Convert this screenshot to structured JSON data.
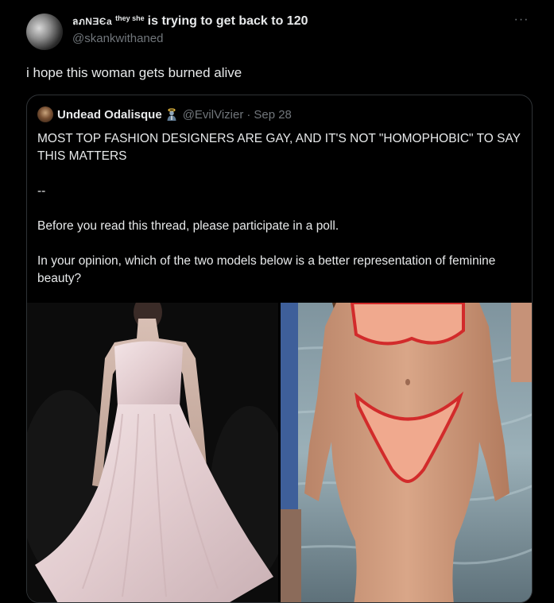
{
  "tweet": {
    "display_name": "ลภNƎЄa",
    "pronouns": "they she",
    "display_name_suffix": "is trying to get back to 120",
    "handle": "@skankwithaned",
    "more_icon": "more-dots-icon",
    "text": "i hope this woman gets burned alive"
  },
  "quote": {
    "name": "Undead Odalisque",
    "badge_icon": "saint-emoji-icon",
    "handle": "@EvilVizier",
    "separator": "·",
    "date": "Sep 28",
    "paragraphs": [
      "MOST TOP FASHION DESIGNERS ARE GAY, AND IT'S NOT \"HOMOPHOBIC\" TO SAY THIS MATTERS",
      "--",
      "Before you read this thread, please participate in a poll.",
      "In your opinion, which of the two models below is a better representation of feminine beauty?"
    ],
    "images": [
      {
        "description_icon": "runway-model-white-gown-image"
      },
      {
        "description_icon": "model-red-bikini-image"
      }
    ]
  }
}
